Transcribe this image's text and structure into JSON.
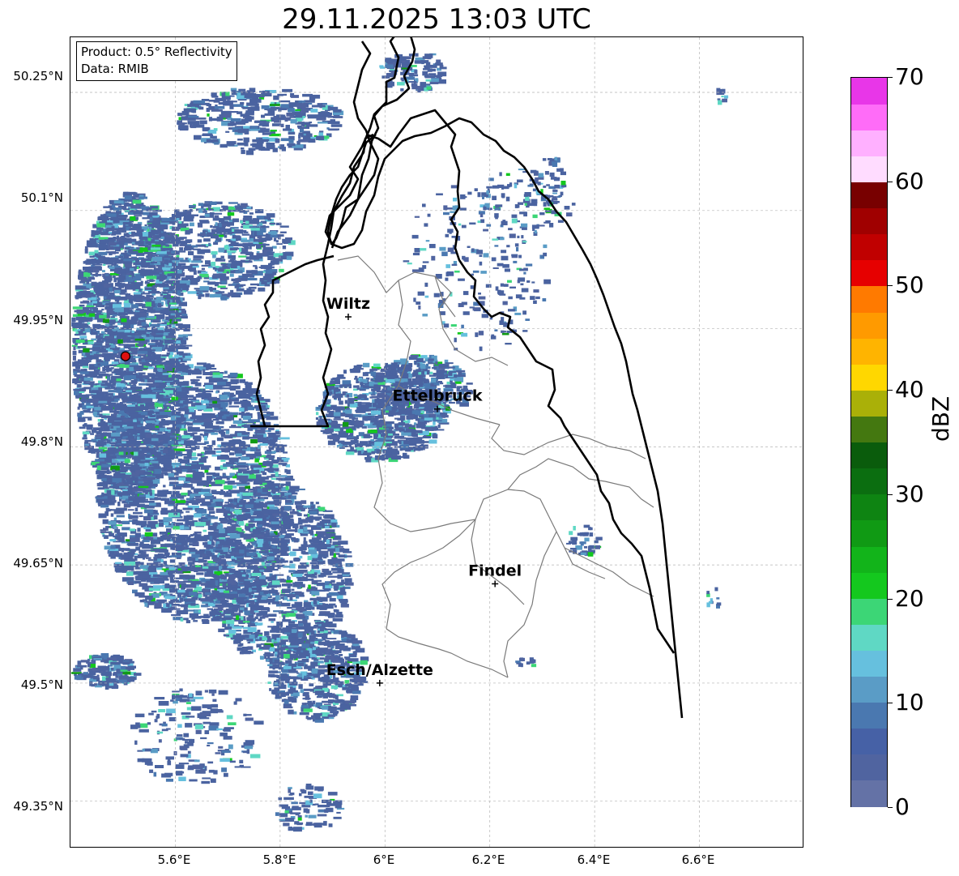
{
  "title": "29.11.2025 13:03 UTC",
  "info": {
    "product": "Product: 0.5° Reflectivity",
    "data": "Data: RMIB"
  },
  "lat_ticks": [
    "50.25°N",
    "50.1°N",
    "49.95°N",
    "49.8°N",
    "49.65°N",
    "49.5°N",
    "49.35°N"
  ],
  "lon_ticks": [
    "5.6°E",
    "5.8°E",
    "6°E",
    "6.2°E",
    "6.4°E",
    "6.6°E"
  ],
  "cities": [
    {
      "name": "Wiltz",
      "lon": 5.93,
      "lat": 49.965
    },
    {
      "name": "Ettelbruck",
      "lon": 6.1,
      "lat": 49.848
    },
    {
      "name": "Findel",
      "lon": 6.21,
      "lat": 49.626
    },
    {
      "name": "Esch/Alzette",
      "lon": 5.99,
      "lat": 49.5
    }
  ],
  "radar_site": {
    "lon": 5.505,
    "lat": 49.915,
    "color": "#dd1111"
  },
  "colorbar": {
    "label": "dBZ",
    "min": 0,
    "max": 70,
    "tick_labels": [
      "0",
      "10",
      "20",
      "30",
      "40",
      "50",
      "60",
      "70"
    ],
    "colors": [
      "#6472a6",
      "#5064a0",
      "#4661a6",
      "#4a78b0",
      "#5a9cc6",
      "#66c0de",
      "#5fd8c4",
      "#3cd676",
      "#14c81e",
      "#12b41a",
      "#109a14",
      "#0e8412",
      "#0b6e10",
      "#0a5c0c",
      "#447810",
      "#aab008",
      "#ffd700",
      "#ffb400",
      "#ff9a00",
      "#ff7a00",
      "#e60000",
      "#c00000",
      "#a00000",
      "#780000",
      "#ffdcff",
      "#ffb0ff",
      "#ff6cf8",
      "#e836e8"
    ]
  },
  "map_extent": {
    "lon_min": 5.4,
    "lon_max": 6.8,
    "lat_min": 49.3,
    "lat_max": 50.3
  },
  "colors": {
    "border": "#000000",
    "canton": "#7a7a7a",
    "grid": "#b4b4b4",
    "echo_dominant": "#4a63a0"
  }
}
